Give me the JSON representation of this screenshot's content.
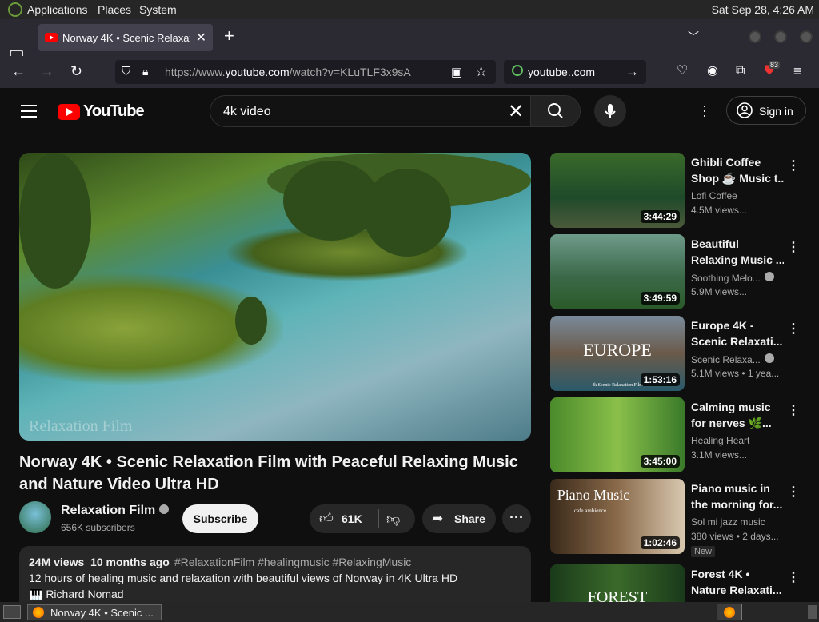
{
  "system_bar": {
    "menu": [
      "Applications",
      "Places",
      "System"
    ],
    "clock": "Sat Sep 28,  4:26 AM"
  },
  "browser": {
    "tab_title": "Norway 4K • Scenic Relaxati",
    "url_prefix": "https://www.",
    "url_domain": "youtube.com",
    "url_path": "/watch?v=KLuTLF3x9sA",
    "search_engine_text": "youtube..com",
    "extension_badge": "83"
  },
  "youtube": {
    "logo_text": "YouTube",
    "search_query": "4k video",
    "sign_in_label": "Sign in",
    "video": {
      "title": "Norway 4K • Scenic Relaxation Film with Peaceful Relaxing Music and Nature Video Ultra HD",
      "watermark": "Relaxation Film",
      "channel": "Relaxation Film",
      "subscribers": "656K subscribers",
      "subscribe_label": "Subscribe",
      "likes": "61K",
      "share_label": "Share",
      "views": "24M views",
      "age": "10 months ago",
      "tags": "#RelaxationFilm #healingmusic #RelaxingMusic",
      "description_line1": "12 hours of healing music and relaxation with beautiful views of Norway in 4K Ultra HD",
      "description_line2": "🎹 Richard Nomad"
    },
    "recommendations": [
      {
        "title1": "Ghibli Coffee",
        "title2": "Shop ☕ Music t...",
        "channel": "Lofi Coffee",
        "verified": false,
        "views": "4.5M views...",
        "duration": "3:44:29",
        "thumb_label": "",
        "is_new": false
      },
      {
        "title1": "Beautiful",
        "title2": "Relaxing Music ...",
        "channel": "Soothing Melo...",
        "verified": true,
        "views": "5.9M views...",
        "duration": "3:49:59",
        "thumb_label": "",
        "is_new": false
      },
      {
        "title1": "Europe 4K -",
        "title2": "Scenic Relaxati...",
        "channel": "Scenic Relaxa...",
        "verified": true,
        "views": "5.1M views  • 1 yea...",
        "duration": "1:53:16",
        "thumb_label": "EUROPE",
        "thumb_sublabel": "4k Scenic Relaxation Film",
        "is_new": false
      },
      {
        "title1": "Calming music",
        "title2": "for nerves 🌿...",
        "channel": "Healing Heart",
        "verified": false,
        "views": "3.1M views...",
        "duration": "3:45:00",
        "thumb_label": "",
        "is_new": false
      },
      {
        "title1": "Piano music in",
        "title2": "the morning for...",
        "channel": "Sol mi jazz music",
        "verified": false,
        "views": "380 views  • 2 days...",
        "duration": "1:02:46",
        "thumb_label": "Piano Music",
        "thumb_sublabel": "cafe ambience",
        "is_new": true,
        "new_label": "New"
      },
      {
        "title1": "Forest 4K •",
        "title2": "Nature Relaxati...",
        "channel": "",
        "verified": false,
        "views": "",
        "duration": "",
        "thumb_label": "FOREST",
        "is_new": false
      }
    ]
  },
  "taskbar": {
    "window_label": "Norway 4K • Scenic ..."
  },
  "colors": {
    "brand_red": "#ff0000",
    "yt_background": "#0f0f0f",
    "link_blue": "#3ea6ff"
  }
}
